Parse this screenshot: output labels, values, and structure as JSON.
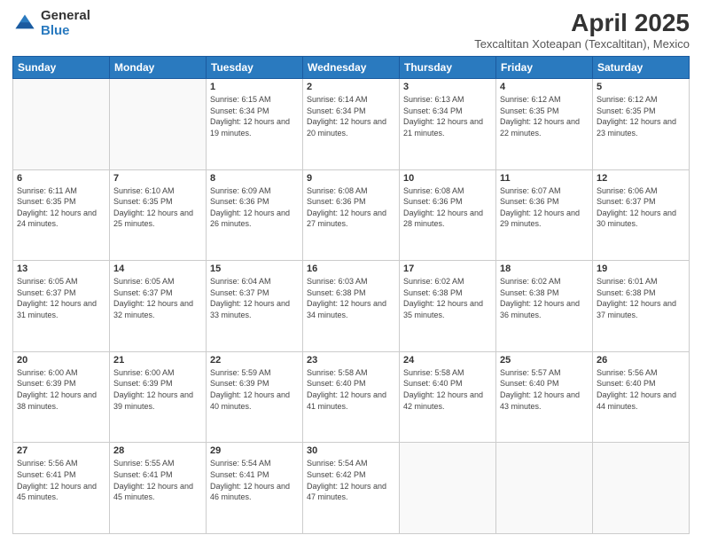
{
  "logo": {
    "general": "General",
    "blue": "Blue"
  },
  "title": {
    "month": "April 2025",
    "location": "Texcaltitan Xoteapan (Texcaltitan), Mexico"
  },
  "days_of_week": [
    "Sunday",
    "Monday",
    "Tuesday",
    "Wednesday",
    "Thursday",
    "Friday",
    "Saturday"
  ],
  "weeks": [
    [
      {
        "day": "",
        "info": ""
      },
      {
        "day": "",
        "info": ""
      },
      {
        "day": "1",
        "info": "Sunrise: 6:15 AM\nSunset: 6:34 PM\nDaylight: 12 hours and 19 minutes."
      },
      {
        "day": "2",
        "info": "Sunrise: 6:14 AM\nSunset: 6:34 PM\nDaylight: 12 hours and 20 minutes."
      },
      {
        "day": "3",
        "info": "Sunrise: 6:13 AM\nSunset: 6:34 PM\nDaylight: 12 hours and 21 minutes."
      },
      {
        "day": "4",
        "info": "Sunrise: 6:12 AM\nSunset: 6:35 PM\nDaylight: 12 hours and 22 minutes."
      },
      {
        "day": "5",
        "info": "Sunrise: 6:12 AM\nSunset: 6:35 PM\nDaylight: 12 hours and 23 minutes."
      }
    ],
    [
      {
        "day": "6",
        "info": "Sunrise: 6:11 AM\nSunset: 6:35 PM\nDaylight: 12 hours and 24 minutes."
      },
      {
        "day": "7",
        "info": "Sunrise: 6:10 AM\nSunset: 6:35 PM\nDaylight: 12 hours and 25 minutes."
      },
      {
        "day": "8",
        "info": "Sunrise: 6:09 AM\nSunset: 6:36 PM\nDaylight: 12 hours and 26 minutes."
      },
      {
        "day": "9",
        "info": "Sunrise: 6:08 AM\nSunset: 6:36 PM\nDaylight: 12 hours and 27 minutes."
      },
      {
        "day": "10",
        "info": "Sunrise: 6:08 AM\nSunset: 6:36 PM\nDaylight: 12 hours and 28 minutes."
      },
      {
        "day": "11",
        "info": "Sunrise: 6:07 AM\nSunset: 6:36 PM\nDaylight: 12 hours and 29 minutes."
      },
      {
        "day": "12",
        "info": "Sunrise: 6:06 AM\nSunset: 6:37 PM\nDaylight: 12 hours and 30 minutes."
      }
    ],
    [
      {
        "day": "13",
        "info": "Sunrise: 6:05 AM\nSunset: 6:37 PM\nDaylight: 12 hours and 31 minutes."
      },
      {
        "day": "14",
        "info": "Sunrise: 6:05 AM\nSunset: 6:37 PM\nDaylight: 12 hours and 32 minutes."
      },
      {
        "day": "15",
        "info": "Sunrise: 6:04 AM\nSunset: 6:37 PM\nDaylight: 12 hours and 33 minutes."
      },
      {
        "day": "16",
        "info": "Sunrise: 6:03 AM\nSunset: 6:38 PM\nDaylight: 12 hours and 34 minutes."
      },
      {
        "day": "17",
        "info": "Sunrise: 6:02 AM\nSunset: 6:38 PM\nDaylight: 12 hours and 35 minutes."
      },
      {
        "day": "18",
        "info": "Sunrise: 6:02 AM\nSunset: 6:38 PM\nDaylight: 12 hours and 36 minutes."
      },
      {
        "day": "19",
        "info": "Sunrise: 6:01 AM\nSunset: 6:38 PM\nDaylight: 12 hours and 37 minutes."
      }
    ],
    [
      {
        "day": "20",
        "info": "Sunrise: 6:00 AM\nSunset: 6:39 PM\nDaylight: 12 hours and 38 minutes."
      },
      {
        "day": "21",
        "info": "Sunrise: 6:00 AM\nSunset: 6:39 PM\nDaylight: 12 hours and 39 minutes."
      },
      {
        "day": "22",
        "info": "Sunrise: 5:59 AM\nSunset: 6:39 PM\nDaylight: 12 hours and 40 minutes."
      },
      {
        "day": "23",
        "info": "Sunrise: 5:58 AM\nSunset: 6:40 PM\nDaylight: 12 hours and 41 minutes."
      },
      {
        "day": "24",
        "info": "Sunrise: 5:58 AM\nSunset: 6:40 PM\nDaylight: 12 hours and 42 minutes."
      },
      {
        "day": "25",
        "info": "Sunrise: 5:57 AM\nSunset: 6:40 PM\nDaylight: 12 hours and 43 minutes."
      },
      {
        "day": "26",
        "info": "Sunrise: 5:56 AM\nSunset: 6:40 PM\nDaylight: 12 hours and 44 minutes."
      }
    ],
    [
      {
        "day": "27",
        "info": "Sunrise: 5:56 AM\nSunset: 6:41 PM\nDaylight: 12 hours and 45 minutes."
      },
      {
        "day": "28",
        "info": "Sunrise: 5:55 AM\nSunset: 6:41 PM\nDaylight: 12 hours and 45 minutes."
      },
      {
        "day": "29",
        "info": "Sunrise: 5:54 AM\nSunset: 6:41 PM\nDaylight: 12 hours and 46 minutes."
      },
      {
        "day": "30",
        "info": "Sunrise: 5:54 AM\nSunset: 6:42 PM\nDaylight: 12 hours and 47 minutes."
      },
      {
        "day": "",
        "info": ""
      },
      {
        "day": "",
        "info": ""
      },
      {
        "day": "",
        "info": ""
      }
    ]
  ]
}
